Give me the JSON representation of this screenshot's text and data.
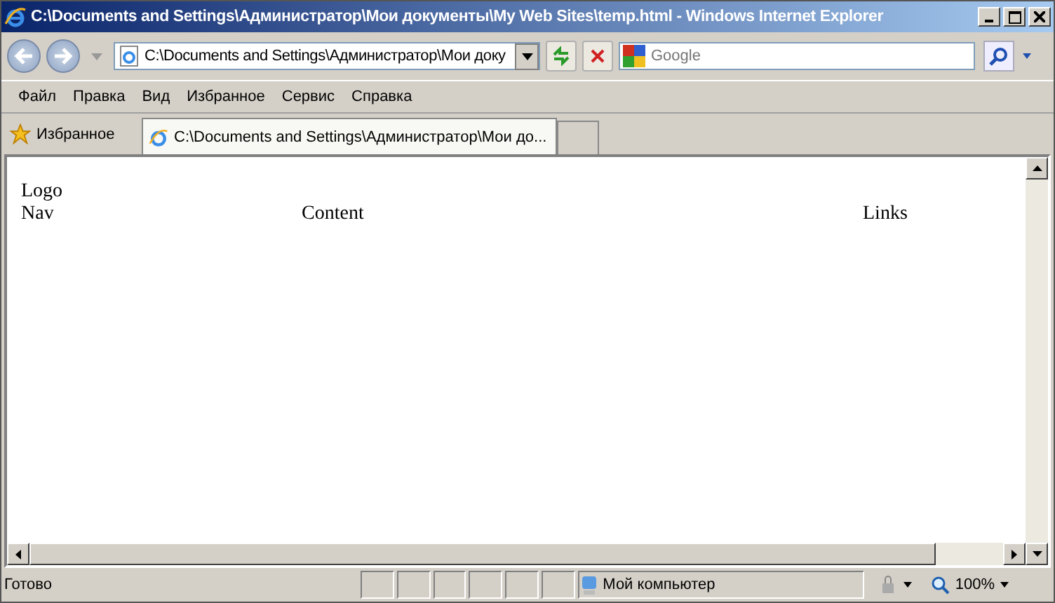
{
  "window": {
    "title": "C:\\Documents and Settings\\Администратор\\Мои документы\\My Web Sites\\temp.html - Windows Internet Explorer"
  },
  "address_bar": {
    "value": "C:\\Documents and Settings\\Администратор\\Мои доку"
  },
  "search": {
    "placeholder": "Google"
  },
  "menu": [
    "Файл",
    "Правка",
    "Вид",
    "Избранное",
    "Сервис",
    "Справка"
  ],
  "favorites": {
    "label": "Избранное"
  },
  "tabs": [
    {
      "label": "C:\\Documents and Settings\\Администратор\\Мои до...",
      "selected": true
    }
  ],
  "page": {
    "logo": "Logo",
    "nav": "Nav",
    "content": "Content",
    "links": "Links"
  },
  "status_bar": {
    "status": "Готово",
    "zone": "Мой компьютер",
    "zoom": "100%"
  }
}
